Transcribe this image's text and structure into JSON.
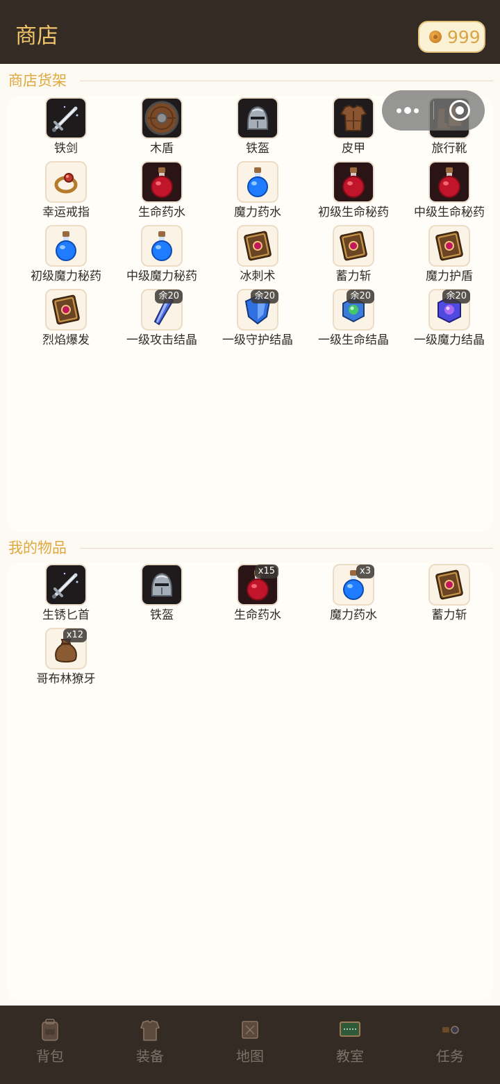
{
  "header": {
    "title": "商店",
    "coins": "999"
  },
  "shop": {
    "title": "商店货架",
    "items": [
      {
        "label": "铁剑",
        "icon": "sword-icon",
        "badge": ""
      },
      {
        "label": "木盾",
        "icon": "shield-icon",
        "badge": ""
      },
      {
        "label": "铁盔",
        "icon": "helmet-icon",
        "badge": ""
      },
      {
        "label": "皮甲",
        "icon": "armor-icon",
        "badge": ""
      },
      {
        "label": "旅行靴",
        "icon": "boots-icon",
        "badge": ""
      },
      {
        "label": "幸运戒指",
        "icon": "ring-icon",
        "badge": ""
      },
      {
        "label": "生命药水",
        "icon": "red-potion-icon",
        "badge": ""
      },
      {
        "label": "魔力药水",
        "icon": "blue-potion-icon",
        "badge": ""
      },
      {
        "label": "初级生命秘药",
        "icon": "red-potion-icon",
        "badge": ""
      },
      {
        "label": "中级生命秘药",
        "icon": "red-potion-icon",
        "badge": ""
      },
      {
        "label": "初级魔力秘药",
        "icon": "blue-potion-icon",
        "badge": ""
      },
      {
        "label": "中级魔力秘药",
        "icon": "blue-potion-icon",
        "badge": ""
      },
      {
        "label": "冰刺术",
        "icon": "spellbook-icon",
        "badge": ""
      },
      {
        "label": "蓄力斩",
        "icon": "spellbook-icon",
        "badge": ""
      },
      {
        "label": "魔力护盾",
        "icon": "spellbook-icon",
        "badge": ""
      },
      {
        "label": "烈焰爆发",
        "icon": "spellbook-icon",
        "badge": ""
      },
      {
        "label": "一级攻击结晶",
        "icon": "attack-crystal-icon",
        "badge": "余20"
      },
      {
        "label": "一级守护结晶",
        "icon": "guard-crystal-icon",
        "badge": "余20"
      },
      {
        "label": "一级生命结晶",
        "icon": "life-crystal-icon",
        "badge": "余20"
      },
      {
        "label": "一级魔力结晶",
        "icon": "mana-crystal-icon",
        "badge": "余20"
      }
    ]
  },
  "inventory": {
    "title": "我的物品",
    "items": [
      {
        "label": "生锈匕首",
        "icon": "sword-icon",
        "badge": ""
      },
      {
        "label": "铁盔",
        "icon": "helmet-icon",
        "badge": ""
      },
      {
        "label": "生命药水",
        "icon": "red-potion-icon",
        "badge": "x15"
      },
      {
        "label": "魔力药水",
        "icon": "blue-potion-icon",
        "badge": "x3"
      },
      {
        "label": "蓄力斩",
        "icon": "spellbook-icon",
        "badge": ""
      },
      {
        "label": "哥布林獠牙",
        "icon": "loot-bag-icon",
        "badge": "x12"
      }
    ]
  },
  "nav": [
    {
      "label": "背包",
      "icon": "backpack-icon"
    },
    {
      "label": "装备",
      "icon": "equipment-icon"
    },
    {
      "label": "地图",
      "icon": "map-icon"
    },
    {
      "label": "教室",
      "icon": "classroom-icon"
    },
    {
      "label": "任务",
      "icon": "quest-icon"
    }
  ]
}
